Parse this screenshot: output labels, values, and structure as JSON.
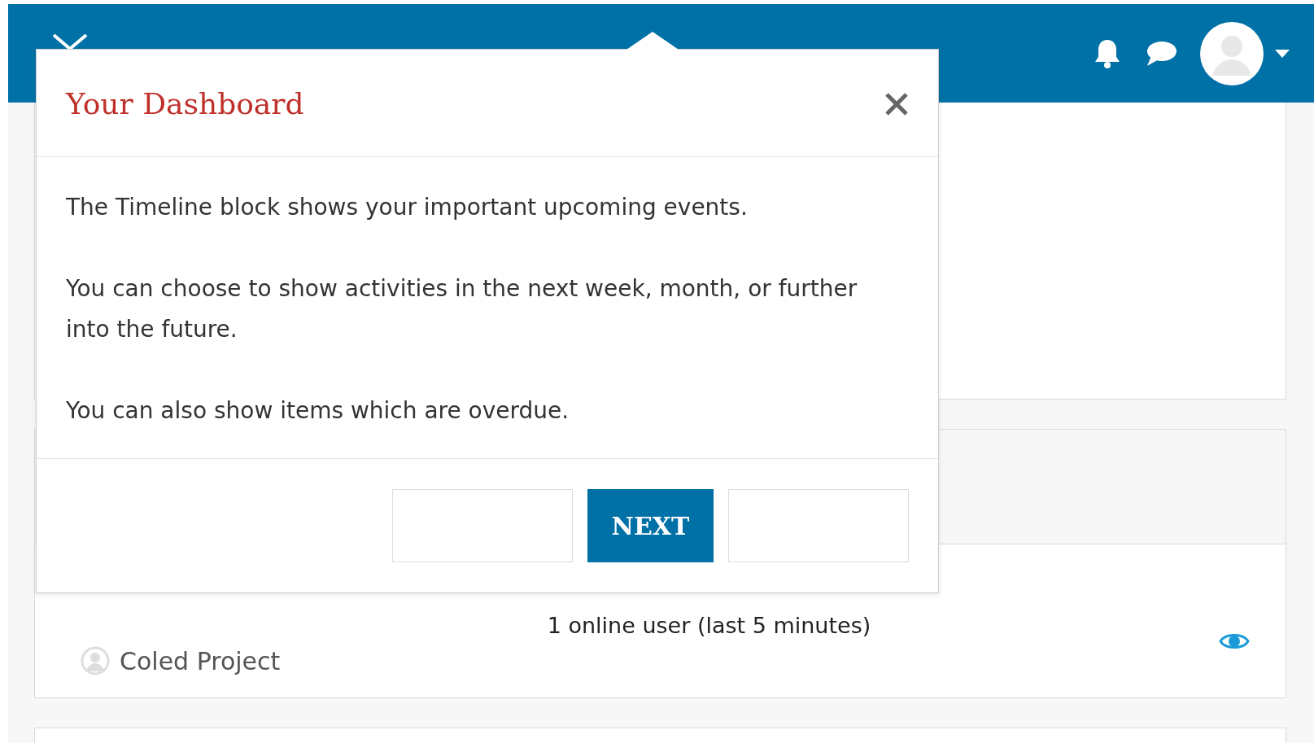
{
  "tour": {
    "title": "Your Dashboard",
    "paragraphs": [
      "The Timeline block shows your important upcoming events.",
      "You can choose to show activities in the next week, month, or further into the future.",
      "You can also show items which are overdue."
    ],
    "next_button": "NEXT"
  },
  "online_users": {
    "summary": "1 online user (last 5 minutes)",
    "users": [
      {
        "name": "Coled Project"
      }
    ]
  }
}
